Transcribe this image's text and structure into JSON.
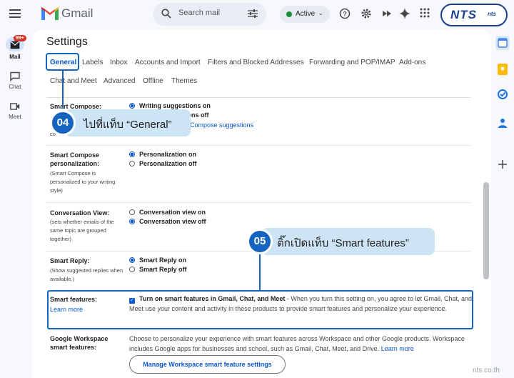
{
  "app": {
    "brand": "Gmail"
  },
  "search": {
    "placeholder": "Search mail"
  },
  "status": {
    "label": "Active",
    "color": "#1e8e3e"
  },
  "toolbar_icons": [
    "help-icon",
    "gear-icon",
    "gemini-magic-icon",
    "sparkle-icon",
    "apps-grid-icon"
  ],
  "nts_logo": {
    "main": "NTS",
    "small": "nts"
  },
  "left_rail": {
    "mail_label": "Mail",
    "mail_badge": "99+",
    "chat_label": "Chat",
    "meet_label": "Meet"
  },
  "settings": {
    "title": "Settings",
    "tabs_row1": [
      "General",
      "Labels",
      "Inbox",
      "Accounts and Import",
      "Filters and Blocked Addresses",
      "Forwarding and POP/IMAP",
      "Add-ons"
    ],
    "tabs_row2": [
      "Chat and Meet",
      "Advanced",
      "Offline",
      "Themes"
    ],
    "smart_compose": {
      "label": "Smart Compose:",
      "opt_on": "Writing suggestions on",
      "opt_off": "ions off",
      "desc": "co",
      "link": "Compose suggestions"
    },
    "smart_compose_personalization": {
      "label": "Smart Compose personalization:",
      "desc": "(Smart Compose is personalized to your writing style)",
      "opt_on": "Personalization on",
      "opt_off": "Personalization off"
    },
    "conversation_view": {
      "label": "Conversation View:",
      "desc": "(sets whether emails of the same topic are grouped together)",
      "opt_on": "Conversation view on",
      "opt_off": "Conversation view off"
    },
    "smart_reply": {
      "label": "Smart Reply:",
      "desc": "(Show suggested replies when available.)",
      "opt_on": "Smart Reply on",
      "opt_off": "Smart Reply off"
    },
    "smart_features": {
      "label": "Smart features:",
      "learn_more": "Learn more",
      "check_label": "Turn on smart features in Gmail, Chat, and Meet",
      "text": " - When you turn this setting on, you agree to let Gmail, Chat, and Meet use your content and activity in these products to provide smart features and personalize your experience."
    },
    "workspace": {
      "label": "Google Workspace smart features:",
      "text": "Choose to personalize your experience with smart features across Workspace and other Google products. Workspace includes Google apps for businesses and school, such as Gmail, Chat, Meet, and Drive.",
      "learn_more": "Learn more",
      "button": "Manage Workspace smart feature settings"
    }
  },
  "annotations": {
    "step4": {
      "num": "04",
      "text": "ไปที่แท็บ “General”"
    },
    "step5": {
      "num": "05",
      "text": "ติ๊กเปิดแท็บ “Smart features”"
    }
  },
  "watermark": "nts.co.th"
}
